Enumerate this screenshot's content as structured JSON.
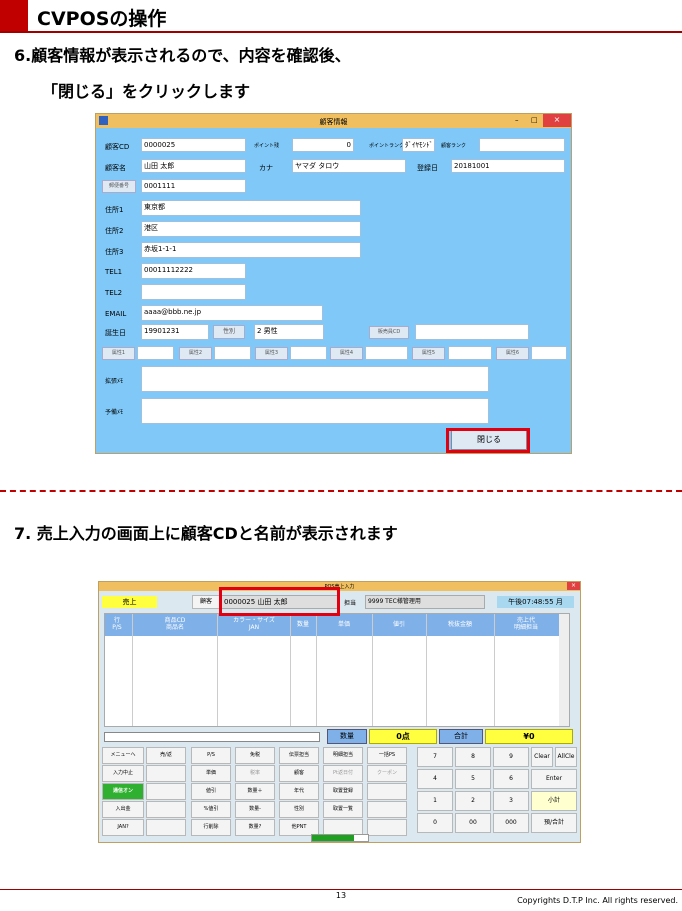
{
  "page": {
    "title": "CVPOSの操作",
    "step6_line1": "6.顧客情報が表示されるので、内容を確認後、",
    "step6_line2": "「閉じる」をクリックします",
    "step7": "7. 売上入力の画面上に顧客CDと名前が表示されます",
    "page_number": "13",
    "copyright": "Copyrights D.T.P Inc. All rights reserved."
  },
  "customer_dialog": {
    "title": "顧客情報",
    "labels": {
      "cd": "顧客CD",
      "points": "ポイント残",
      "point_rank": "ポイントランク",
      "customer_rank": "顧客ランク",
      "name": "顧客名",
      "kana": "カナ",
      "reg_date": "登録日",
      "zip": "郵便番号",
      "addr1": "住所1",
      "addr2": "住所2",
      "addr3": "住所3",
      "tel1": "TEL1",
      "tel2": "TEL2",
      "email": "EMAIL",
      "birthday": "誕生日",
      "gender": "性別",
      "staff_cd": "販売員CD",
      "ext_memo": "拡張ﾒﾓ",
      "spare_memo": "予備ﾒﾓ"
    },
    "values": {
      "cd": "0000025",
      "points": "0",
      "point_rank": "ﾀﾞｲﾔﾓﾝﾄﾞ",
      "name": "山田 太郎",
      "kana": "ヤマダ タロウ",
      "reg_date": "20181001",
      "zip": "0001111",
      "addr1": "東京都",
      "addr2": "港区",
      "addr3": "赤坂1-1-1",
      "tel1": "00011112222",
      "tel2": "",
      "email": "aaaa@bbb.ne.jp",
      "birthday": "19901231",
      "gender": "2 男性"
    },
    "attributes": [
      "属性1",
      "属性2",
      "属性3",
      "属性4",
      "属性5",
      "属性6"
    ],
    "close_button": "閉じる"
  },
  "pos_screen": {
    "title": "POS売上入力",
    "mode": "売上",
    "customer_label": "顧客",
    "customer_value": "0000025 山田 太郎",
    "staff_label": "担当",
    "staff_value": "9999 TEC様管理用",
    "clock": "午後07:48:55 月",
    "columns": [
      {
        "top": "行",
        "bottom": "P/S"
      },
      {
        "top": "商品CD",
        "bottom": "商品名"
      },
      {
        "top": "カラー・サイズ",
        "bottom": "JAN"
      },
      {
        "top": "数量",
        "bottom": ""
      },
      {
        "top": "単価",
        "bottom": ""
      },
      {
        "top": "値引",
        "bottom": ""
      },
      {
        "top": "税抜金額",
        "bottom": ""
      },
      {
        "top": "売上代",
        "bottom": "明細担当"
      }
    ],
    "qty_label": "数量",
    "qty_value": "0点",
    "total_label": "合計",
    "total_value": "¥0",
    "function_keys": [
      [
        "メニューへ",
        "売/返",
        "P/S",
        "免税",
        "伝票担当",
        "明細担当",
        "一括PS"
      ],
      [
        "入力中止",
        "",
        "単価",
        "税率",
        "顧客",
        "Pt返日付",
        "クーポン"
      ],
      [
        "通信オン",
        "",
        "値引",
        "数量＋",
        "年代",
        "取置登録",
        ""
      ],
      [
        "入出金",
        "",
        "%値引",
        "数量-",
        "性別",
        "取置一覧",
        ""
      ],
      [
        "JAN?",
        "",
        "行削除",
        "数量?",
        "他PNT",
        "",
        ""
      ]
    ],
    "numpad": [
      [
        "7",
        "8",
        "9",
        "Clear",
        "AllCle"
      ],
      [
        "4",
        "5",
        "6",
        "Enter"
      ],
      [
        "1",
        "2",
        "3",
        "小計"
      ],
      [
        "0",
        "00",
        "000",
        "預/合計"
      ]
    ],
    "colors": {
      "mode_bg": "#ffff40",
      "comm_on": "#30b030",
      "progress": "#20a020"
    }
  },
  "colors": {
    "accent_red": "#c00000",
    "highlight_box": "#e00010",
    "dialog_bg": "#7fc8f8"
  }
}
